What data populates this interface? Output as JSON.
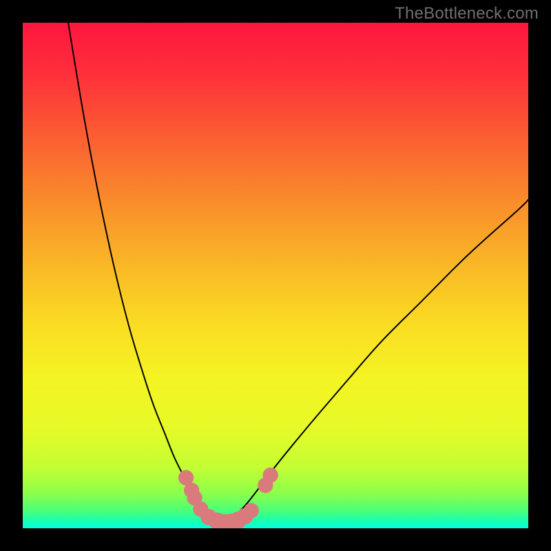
{
  "watermark": "TheBottleneck.com",
  "chart_data": {
    "type": "line",
    "title": "",
    "xlabel": "",
    "ylabel": "",
    "xlim": [
      0,
      100
    ],
    "ylim": [
      0,
      100
    ],
    "grid": false,
    "legend": false,
    "series": [
      {
        "name": "curve-left",
        "x": [
          9,
          12,
          15,
          18,
          21,
          24,
          26,
          28,
          30,
          32,
          33.5,
          35,
          36,
          37,
          38,
          39,
          40
        ],
        "y": [
          100,
          82,
          66,
          52,
          40,
          30,
          24,
          19,
          14,
          10,
          7,
          5,
          3.5,
          2.5,
          1.8,
          1.2,
          0.8
        ]
      },
      {
        "name": "curve-right",
        "x": [
          40,
          41,
          42,
          44,
          46,
          49,
          53,
          58,
          64,
          71,
          79,
          88,
          98,
          100
        ],
        "y": [
          0.8,
          1.5,
          2.5,
          4.5,
          7,
          11,
          16,
          22,
          29,
          37,
          45,
          54,
          63,
          65
        ]
      }
    ],
    "markers": {
      "name": "highlight-dots",
      "color": "#d97b7d",
      "points": [
        {
          "x": 32.3,
          "y": 10.0,
          "r": 1.6
        },
        {
          "x": 33.4,
          "y": 7.5,
          "r": 1.6
        },
        {
          "x": 34.0,
          "y": 6.0,
          "r": 1.6
        },
        {
          "x": 35.2,
          "y": 3.8,
          "r": 1.6
        },
        {
          "x": 36.8,
          "y": 2.2,
          "r": 1.7
        },
        {
          "x": 38.5,
          "y": 1.4,
          "r": 1.8
        },
        {
          "x": 40.0,
          "y": 1.1,
          "r": 1.8
        },
        {
          "x": 41.3,
          "y": 1.2,
          "r": 1.8
        },
        {
          "x": 42.6,
          "y": 1.6,
          "r": 1.8
        },
        {
          "x": 44.0,
          "y": 2.4,
          "r": 1.7
        },
        {
          "x": 45.2,
          "y": 3.5,
          "r": 1.6
        },
        {
          "x": 48.0,
          "y": 8.5,
          "r": 1.6
        },
        {
          "x": 49.0,
          "y": 10.5,
          "r": 1.6
        }
      ]
    },
    "background_gradient": {
      "type": "vertical",
      "stops": [
        {
          "offset": 0.0,
          "color": "#fe163e"
        },
        {
          "offset": 0.1,
          "color": "#fe2f3b"
        },
        {
          "offset": 0.22,
          "color": "#fb5c32"
        },
        {
          "offset": 0.35,
          "color": "#f98b2b"
        },
        {
          "offset": 0.48,
          "color": "#f9b826"
        },
        {
          "offset": 0.6,
          "color": "#fadd23"
        },
        {
          "offset": 0.7,
          "color": "#f4f323"
        },
        {
          "offset": 0.8,
          "color": "#e7fa27"
        },
        {
          "offset": 0.88,
          "color": "#c3fe33"
        },
        {
          "offset": 0.93,
          "color": "#8dff4a"
        },
        {
          "offset": 0.965,
          "color": "#4bff78"
        },
        {
          "offset": 0.985,
          "color": "#18ffb0"
        },
        {
          "offset": 1.0,
          "color": "#03ffde"
        }
      ]
    }
  }
}
